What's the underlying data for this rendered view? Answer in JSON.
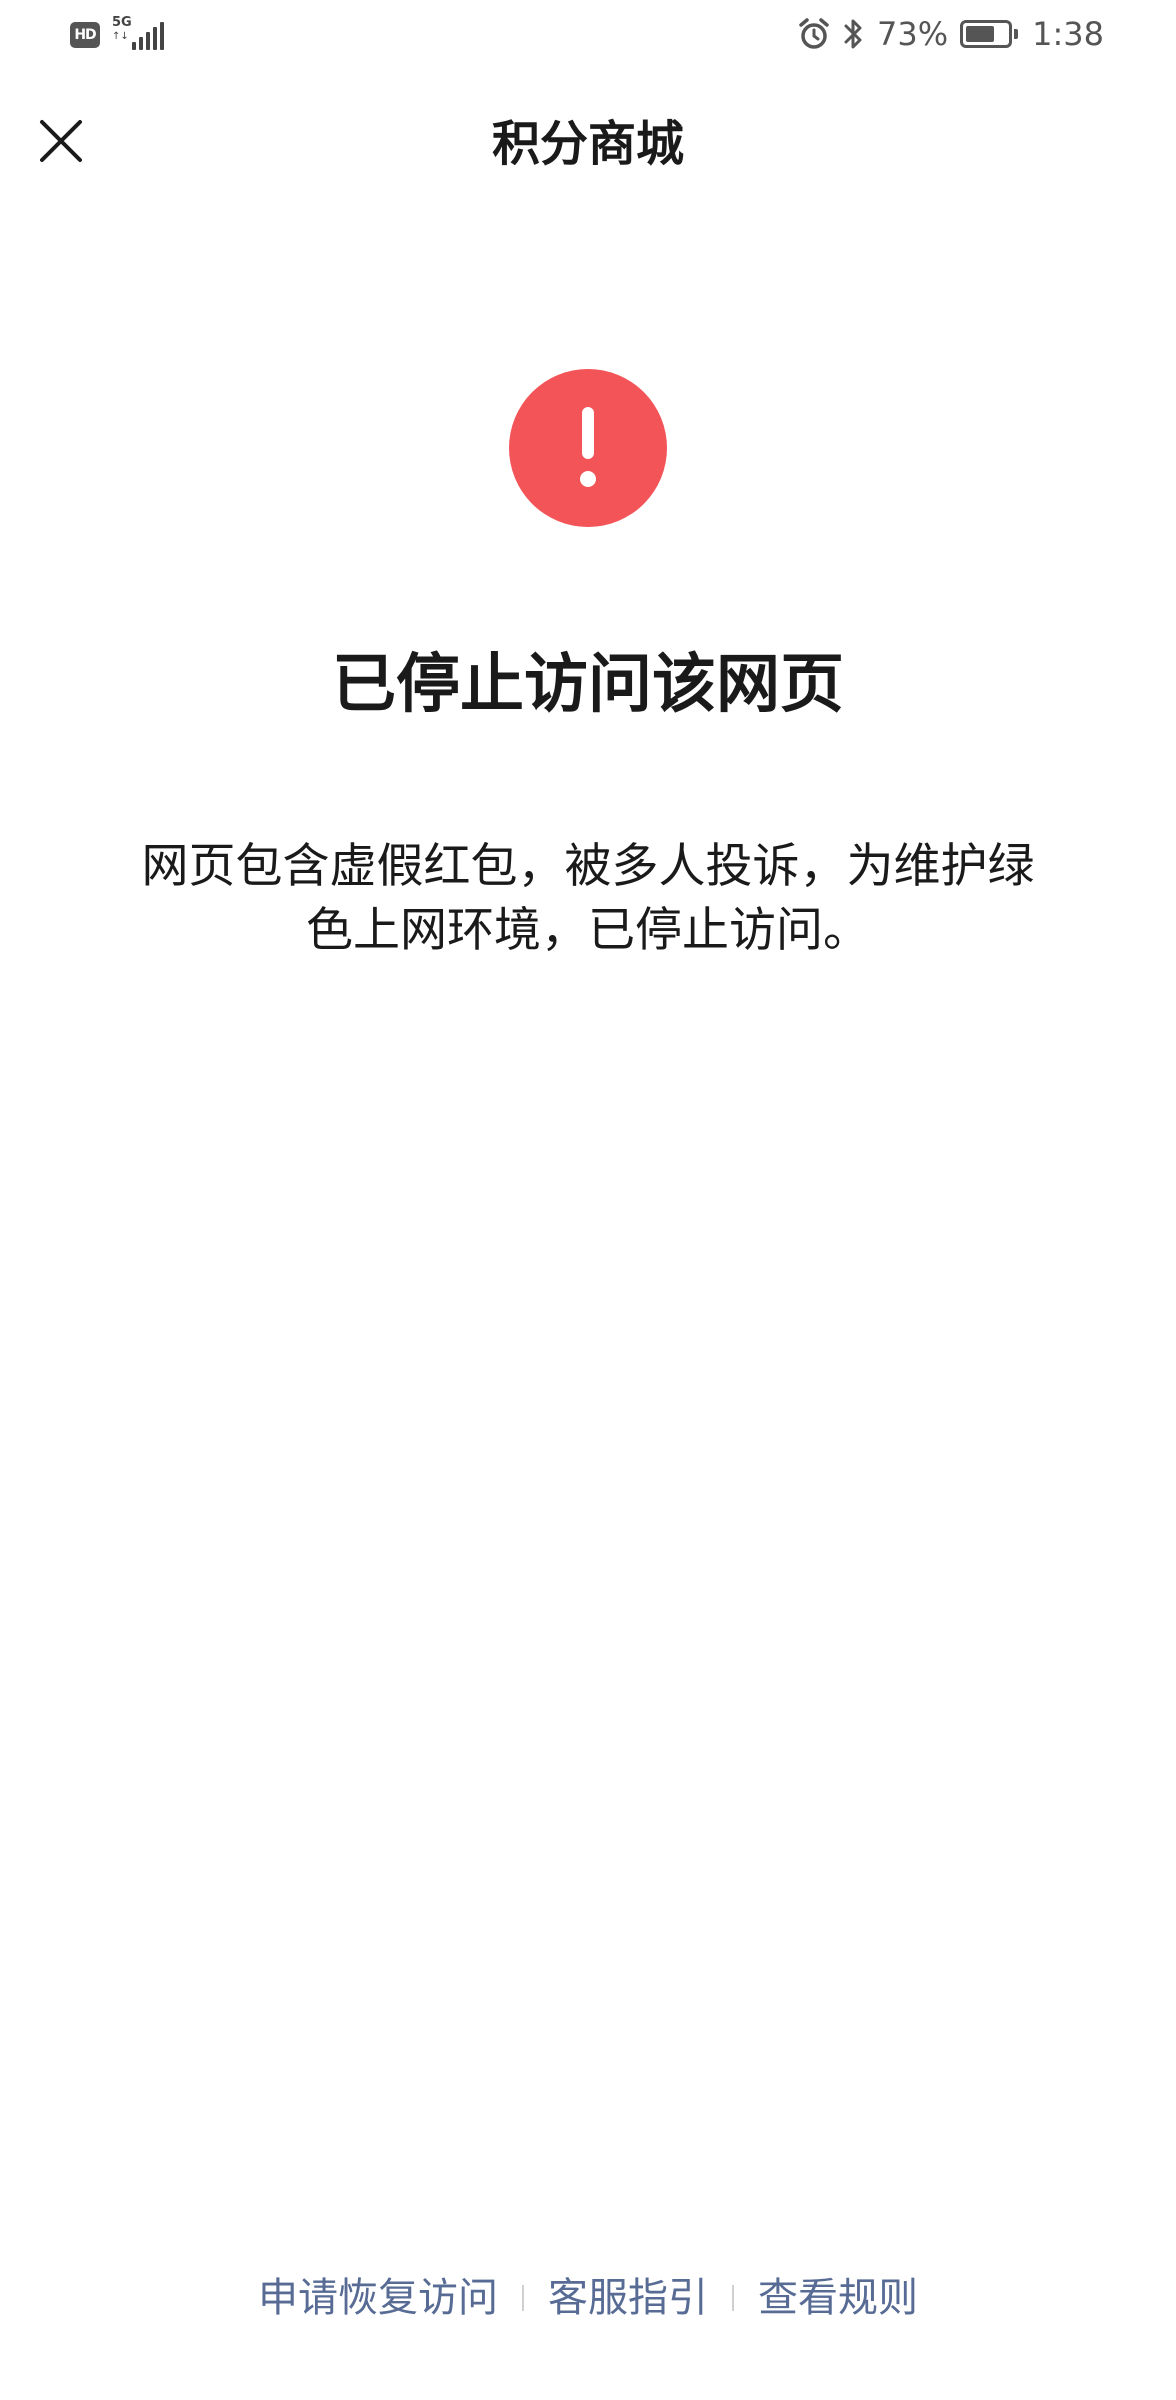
{
  "status_bar": {
    "hd_label": "HD",
    "network_label": "5G",
    "network_sub_label": "↑↓",
    "battery_text": "73%",
    "battery_level": 0.73,
    "time": "1:38",
    "icons": [
      "alarm-icon",
      "bluetooth-icon",
      "battery-icon",
      "signal-icon"
    ]
  },
  "nav": {
    "title": "积分商城",
    "close_icon": "close-icon"
  },
  "main": {
    "icon": "exclamation-icon",
    "icon_color": "#f25458",
    "headline": "已停止访问该网页",
    "description_line1": "网页包含虚假红包，被多人投诉，为维护绿",
    "description_line2": "色上网环境，已停止访问。"
  },
  "footer": {
    "links": [
      {
        "label": "申请恢复访问"
      },
      {
        "label": "客服指引"
      },
      {
        "label": "查看规则"
      }
    ],
    "link_color": "#576b95"
  }
}
